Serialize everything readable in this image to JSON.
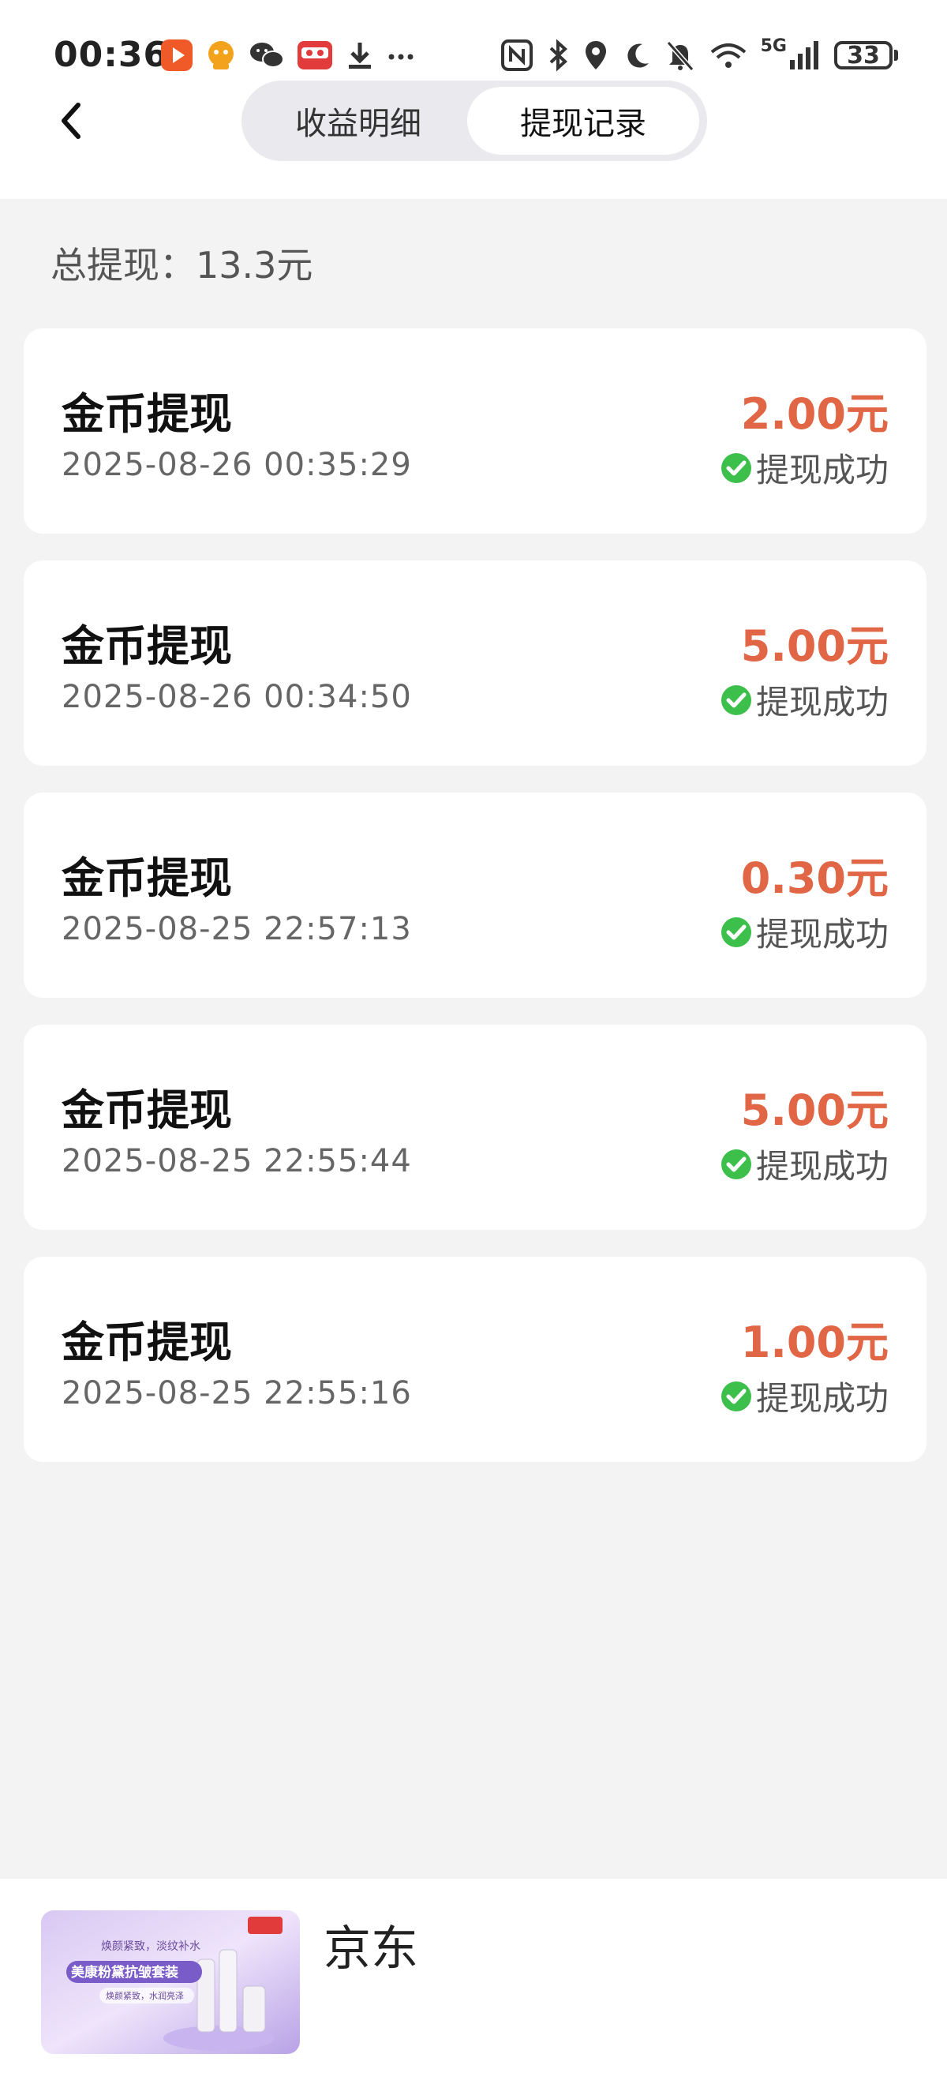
{
  "status_bar": {
    "time": "00:36",
    "network": "5G",
    "battery": "33"
  },
  "header": {
    "tabs": [
      {
        "label": "收益明细",
        "active": false
      },
      {
        "label": "提现记录",
        "active": true
      }
    ]
  },
  "summary": {
    "total_label": "总提现：",
    "total_value": "13.3元"
  },
  "records": [
    {
      "title": "金币提现",
      "datetime": "2025-08-26 00:35:29",
      "amount": "2.00元",
      "status": "提现成功"
    },
    {
      "title": "金币提现",
      "datetime": "2025-08-26 00:34:50",
      "amount": "5.00元",
      "status": "提现成功"
    },
    {
      "title": "金币提现",
      "datetime": "2025-08-25 22:57:13",
      "amount": "0.30元",
      "status": "提现成功"
    },
    {
      "title": "金币提现",
      "datetime": "2025-08-25 22:55:44",
      "amount": "5.00元",
      "status": "提现成功"
    },
    {
      "title": "金币提现",
      "datetime": "2025-08-25 22:55:16",
      "amount": "1.00元",
      "status": "提现成功"
    }
  ],
  "ad": {
    "brand": "京东",
    "image_lines": [
      "焕颜紧致，淡纹补水",
      "美康粉黛抗皱套装",
      "焕颜紧致，水润亮泽"
    ]
  },
  "colors": {
    "amount": "#e06646",
    "success": "#3dbf4c",
    "background": "#f3f3f4"
  }
}
